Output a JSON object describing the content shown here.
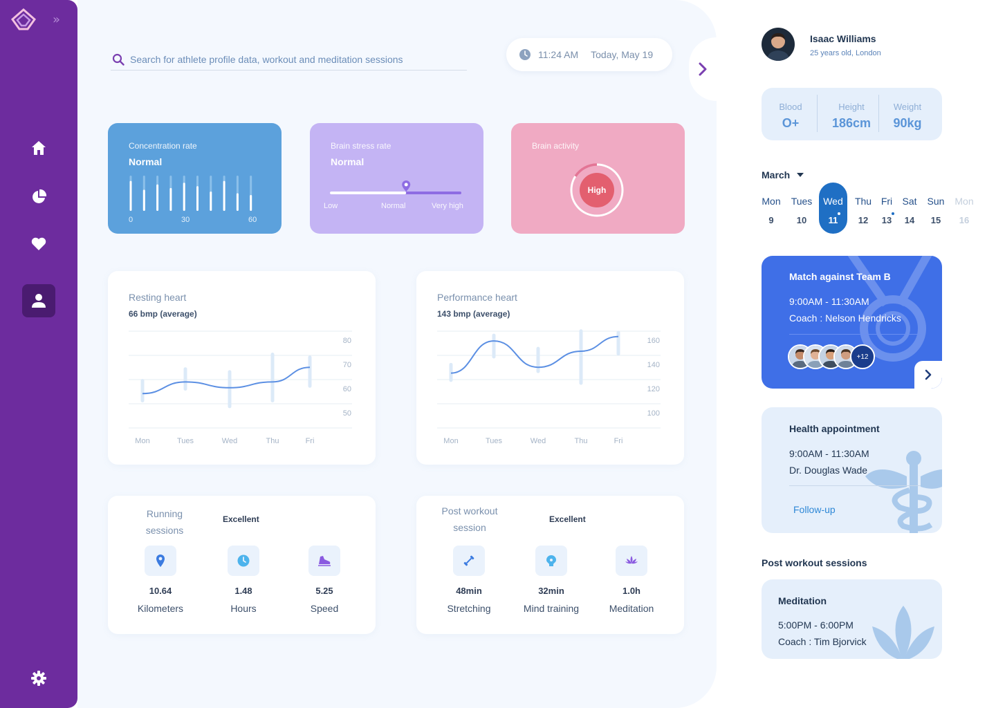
{
  "nav": {
    "items": [
      {
        "id": "home",
        "icon": "home-icon"
      },
      {
        "id": "stats",
        "icon": "pie-chart-icon"
      },
      {
        "id": "health",
        "icon": "heart-icon"
      },
      {
        "id": "profile",
        "icon": "user-icon",
        "active": true
      }
    ],
    "settings_icon": "gear-icon",
    "expand_glyph": "»"
  },
  "search": {
    "placeholder": "Search for athlete profile data, workout and meditation sessions"
  },
  "clock": {
    "time": "11:24 AM",
    "date": "Today, May 19"
  },
  "stat_cards": {
    "concentration": {
      "title": "Concentration rate",
      "value": "Normal",
      "scale": [
        "0",
        "30",
        "60"
      ],
      "bars": [
        0.85,
        0.6,
        0.75,
        0.65,
        0.8,
        0.7,
        0.55,
        0.85,
        0.5,
        0.45
      ]
    },
    "stress": {
      "title": "Brain stress rate",
      "value": "Normal",
      "labels": [
        "Low",
        "Normal",
        "Very high"
      ],
      "level": 0.58
    },
    "activity": {
      "title": "Brain activity",
      "value": "High"
    }
  },
  "charts": {
    "resting": {
      "title": "Resting heart",
      "subtitle": "66 bmp (average)",
      "yticks": [
        "80",
        "70",
        "60",
        "50"
      ],
      "xticks": [
        "Mon",
        "Tues",
        "Wed",
        "Thu",
        "Fri"
      ]
    },
    "performance": {
      "title": "Performance heart",
      "subtitle": "143 bmp (average)",
      "yticks": [
        "160",
        "140",
        "120",
        "100"
      ],
      "xticks": [
        "Mon",
        "Tues",
        "Wed",
        "Thu",
        "Fri"
      ]
    }
  },
  "chart_data": [
    {
      "type": "line",
      "title": "Resting heart",
      "ylim": [
        45,
        80
      ],
      "x": [
        "Mon",
        "Tues",
        "Wed",
        "Thu",
        "Fri"
      ],
      "series": [
        {
          "values": [
            57,
            61,
            59,
            61,
            66
          ]
        }
      ],
      "ranges": [
        [
          54,
          62
        ],
        [
          58,
          66
        ],
        [
          52,
          65
        ],
        [
          54,
          71
        ],
        [
          59,
          70
        ]
      ]
    },
    {
      "type": "line",
      "title": "Performance heart",
      "ylim": [
        90,
        160
      ],
      "x": [
        "Mon",
        "Tues",
        "Wed",
        "Thu",
        "Fri"
      ],
      "series": [
        {
          "values": [
            128,
            150,
            132,
            143,
            153
          ]
        }
      ],
      "ranges": [
        [
          122,
          135
        ],
        [
          138,
          155
        ],
        [
          128,
          146
        ],
        [
          120,
          158
        ],
        [
          140,
          157
        ]
      ]
    }
  ],
  "running": {
    "title_line1": "Running",
    "title_line2": "sessions",
    "rating": "Excellent",
    "items": [
      {
        "value": "10.64",
        "unit": "Kilometers",
        "icon": "location-pin-icon"
      },
      {
        "value": "1.48",
        "unit": "Hours",
        "icon": "clock-icon"
      },
      {
        "value": "5.25",
        "unit": "Speed",
        "icon": "shoe-icon"
      }
    ]
  },
  "post_workout": {
    "title_line1": "Post workout",
    "title_line2": "session",
    "rating": "Excellent",
    "items": [
      {
        "value": "48min",
        "unit": "Stretching",
        "icon": "dumbbell-icon"
      },
      {
        "value": "32min",
        "unit": "Mind training",
        "icon": "brain-icon"
      },
      {
        "value": "1.0h",
        "unit": "Meditation",
        "icon": "lotus-icon"
      }
    ]
  },
  "profile": {
    "name": "Isaac Williams",
    "meta": "25 years old, London"
  },
  "bio": [
    {
      "label": "Blood",
      "value": "O+"
    },
    {
      "label": "Height",
      "value": "186cm"
    },
    {
      "label": "Weight",
      "value": "90kg"
    }
  ],
  "calendar": {
    "month": "March",
    "days": [
      {
        "name": "Mon",
        "num": "9"
      },
      {
        "name": "Tues",
        "num": "10"
      },
      {
        "name": "Wed",
        "num": "11",
        "selected": true
      },
      {
        "name": "Thu",
        "num": "12"
      },
      {
        "name": "Fri",
        "num": "13"
      },
      {
        "name": "Sat",
        "num": "14"
      },
      {
        "name": "Sun",
        "num": "15"
      },
      {
        "name": "Mon",
        "num": "16",
        "dim": true
      }
    ]
  },
  "events": {
    "match": {
      "title": "Match against Team B",
      "time": "9:00AM - 11:30AM",
      "coach": "Coach : Nelson Hendricks",
      "more": "+12"
    },
    "health": {
      "title": "Health appointment",
      "time": "9:00AM - 11:30AM",
      "doctor": "Dr. Douglas Wade",
      "link": "Follow-up"
    }
  },
  "post_sessions": {
    "title": "Post workout sessions",
    "meditation": {
      "title": "Meditation",
      "time": "5:00PM - 6:00PM",
      "coach": "Coach : Tim Bjorvick"
    }
  },
  "colors": {
    "sidebar": "#6d2c9e",
    "accent_blue": "#5ca1dc",
    "accent_purple": "#c4b4f4",
    "accent_pink": "#f0aac3",
    "event_blue": "#3f6fe7"
  }
}
